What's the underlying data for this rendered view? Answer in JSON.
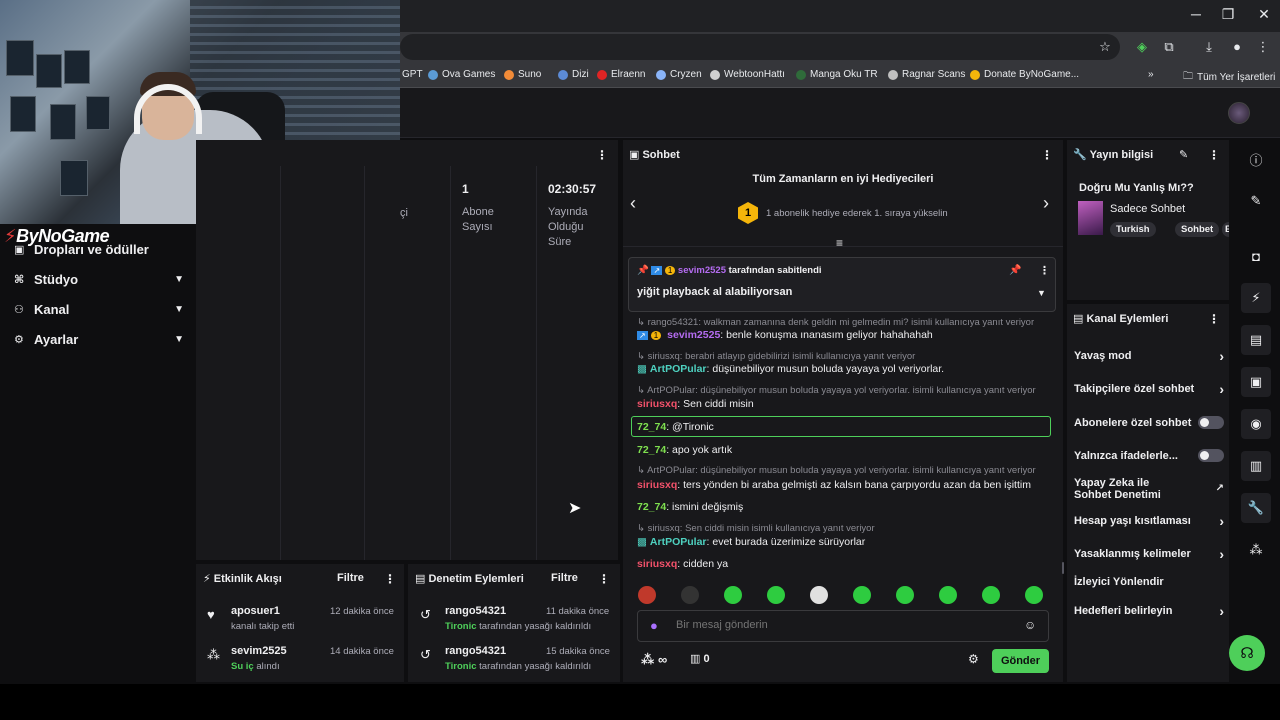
{
  "browser": {
    "bookmarks": [
      {
        "label": "GPT",
        "color": "#8ab4f8"
      },
      {
        "label": "Ova Games",
        "color": "#5b9bd5"
      },
      {
        "label": "Suno",
        "color": "#f28b38"
      },
      {
        "label": "Dizi",
        "color": "#5c8bd6"
      },
      {
        "label": "Elraenn",
        "color": "#e02424"
      },
      {
        "label": "Cryzen",
        "color": "#8ab4f8"
      },
      {
        "label": "WebtoonHattı",
        "color": "#d0d0d0"
      },
      {
        "label": "Manga Oku TR",
        "color": "#2f6b3a"
      },
      {
        "label": "Ragnar Scans",
        "color": "#c0c0c0"
      },
      {
        "label": "Donate ByNoGame...",
        "color": "#f5b50a"
      }
    ],
    "all_bookmarks": "Tüm Yer İşaretleri",
    "more": "»",
    "minimize": "─",
    "maximize": "❐",
    "close": "✕"
  },
  "logo": {
    "mark": "⚡",
    "text": "ByNoGame"
  },
  "sidebar": {
    "partial_items": [
      "Dropları ve ödüller"
    ],
    "items": [
      {
        "label": "Stüdyo",
        "icon": "studio-icon"
      },
      {
        "label": "Kanal",
        "icon": "channel-icon"
      },
      {
        "label": "Ayarlar",
        "icon": "gear-icon"
      }
    ]
  },
  "stats": {
    "partial_label": "çi",
    "columns": [
      {
        "value": "1",
        "label": "Abone Sayısı"
      },
      {
        "value": "02:30:57",
        "label": "Yayında Olduğu Süre"
      }
    ]
  },
  "activity": {
    "title": "Etkinlik Akışı",
    "filter": "Filtre",
    "items": [
      {
        "name": "aposuer1",
        "sub": "kanalı takip etti",
        "time": "12 dakika önce",
        "icon": "heart-icon"
      },
      {
        "name": "sevim2525",
        "sub_highlight": "Su iç",
        "sub": "alındı",
        "time": "14 dakika önce",
        "icon": "points-icon"
      }
    ]
  },
  "moderation": {
    "title": "Denetim Eylemleri",
    "filter": "Filtre",
    "items": [
      {
        "name": "rango54321",
        "by": "Tironic",
        "sub": "tarafından yasağı kaldırıldı",
        "time": "11 dakika önce"
      },
      {
        "name": "rango54321",
        "by": "Tironic",
        "sub": "tarafından yasağı kaldırıldı",
        "time": "15 dakika önce"
      }
    ]
  },
  "chat": {
    "title": "Sohbet",
    "gift_title": "Tüm Zamanların en iyi Hediyecileri",
    "gift_rank": "1",
    "gift_sub": "1 abonelik hediye ederek 1. sıraya yükselin",
    "pinned_by_user": "sevim2525",
    "pinned_by_text": "tarafından sabitlendi",
    "pinned_message": "yiğit playback al alabiliyorsan",
    "messages": [
      {
        "type": "reply",
        "text": "rango54321: walkman zamanına denk geldin mi gelmedin mi? isimli kullanıcıya yanıt veriyor"
      },
      {
        "type": "msg",
        "user": "sevim2525",
        "color": "purple",
        "text": ": benle konuşma ınanasım geliyor hahahahah"
      },
      {
        "type": "reply",
        "text": "siriusxq: berabri atlayıp gidebilirizi isimli kullanıcıya yanıt veriyor"
      },
      {
        "type": "msg",
        "user": "ArtPOPular",
        "color": "teal",
        "text": ": düşünebiliyor musun boluda yayaya yol veriyorlar."
      },
      {
        "type": "reply",
        "text": "ArtPOPular: düşünebiliyor musun boluda yayaya yol veriyorlar. isimli kullanıcıya yanıt veriyor"
      },
      {
        "type": "msg",
        "user": "siriusxq",
        "color": "red",
        "text": ": Sen ciddi misin"
      },
      {
        "type": "msg",
        "user": "72_74",
        "color": "green",
        "text": ": @Tironic"
      },
      {
        "type": "msg",
        "user": "72_74",
        "color": "green",
        "text": ": apo yok artık"
      },
      {
        "type": "reply",
        "text": "ArtPOPular: düşünebiliyor musun boluda yayaya yol veriyorlar. isimli kullanıcıya yanıt veriyor"
      },
      {
        "type": "msg",
        "user": "siriusxq",
        "color": "red",
        "text": ": ters yönden bi araba gelmişti az kalsın bana çarpıyordu azan da ben işittim"
      },
      {
        "type": "msg",
        "user": "72_74",
        "color": "green",
        "text": ": ismini değişmiş"
      },
      {
        "type": "reply",
        "text": "siriusxq: Sen ciddi misin isimli kullanıcıya yanıt veriyor"
      },
      {
        "type": "msg",
        "user": "ArtPOPular",
        "color": "teal",
        "text": ": evet burada üzerimize sürüyorlar"
      },
      {
        "type": "msg",
        "user": "siriusxq",
        "color": "red",
        "text": ": cidden ya"
      }
    ],
    "input_placeholder": "Bir mesaj gönderin",
    "points": "∞",
    "drops": "0",
    "send": "Gönder",
    "emote_colors": [
      "#c0392b",
      "#333333",
      "#2ecc40",
      "#2ecc40",
      "#e0e0e0",
      "#2ecc40",
      "#2ecc40",
      "#2ecc40",
      "#2ecc40",
      "#2ecc40"
    ]
  },
  "stream_info": {
    "title": "Yayın bilgisi",
    "stream_title": "Doğru Mu Yanlış Mı??",
    "category": "Sadece Sohbet",
    "tags": [
      "Turkish",
      "Sohbet",
      "E"
    ]
  },
  "channel_actions": {
    "title": "Kanal Eylemleri",
    "items": [
      {
        "label": "Yavaş mod",
        "control": "chevron"
      },
      {
        "label": "Takipçilere özel sohbet",
        "control": "chevron"
      },
      {
        "label": "Abonelere özel sohbet",
        "control": "toggle"
      },
      {
        "label": "Yalnızca ifadelerle...",
        "control": "toggle"
      },
      {
        "label": "Yapay Zeka ile Sohbet Denetimi",
        "control": "external"
      },
      {
        "label": "Hesap yaşı kısıtlaması",
        "control": "chevron"
      },
      {
        "label": "Yasaklanmış kelimeler",
        "control": "chevron"
      },
      {
        "label": "İzleyici Yönlendir",
        "control": "none"
      },
      {
        "label": "Hedefleri belirleyin",
        "control": "chevron"
      }
    ]
  },
  "colors": {
    "accent_green": "#4ecf5a",
    "panel_bg": "#18181b",
    "page_bg": "#0e0e10"
  }
}
